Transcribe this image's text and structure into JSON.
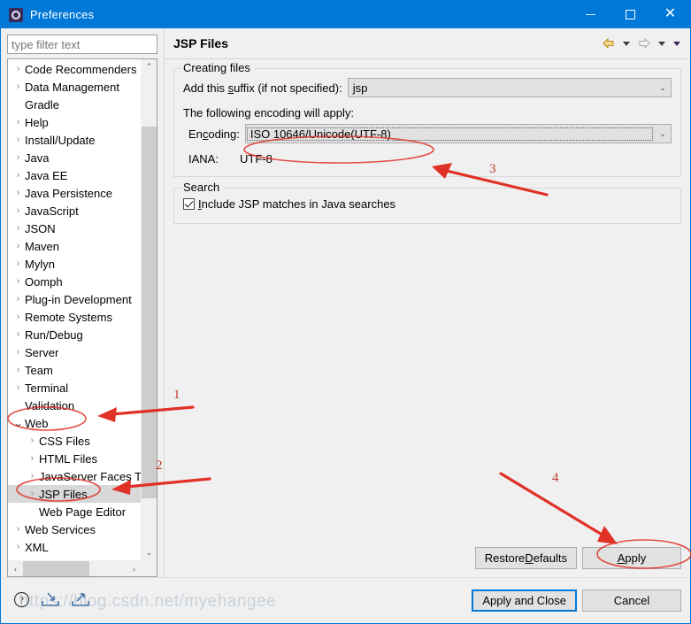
{
  "window": {
    "title": "Preferences",
    "icon": "gear-icon",
    "accent_color": "#0078d7",
    "controls": {
      "minimize": "—",
      "maximize": "□",
      "close": "✕"
    }
  },
  "sidebar": {
    "filter": {
      "placeholder": "type filter text",
      "value": ""
    },
    "tree": [
      {
        "label": "Code Recommenders",
        "expandable": true,
        "expanded": false,
        "indent": 0,
        "selected": false
      },
      {
        "label": "Data Management",
        "expandable": true,
        "expanded": false,
        "indent": 0,
        "selected": false
      },
      {
        "label": "Gradle",
        "expandable": false,
        "expanded": false,
        "indent": 0,
        "selected": false
      },
      {
        "label": "Help",
        "expandable": true,
        "expanded": false,
        "indent": 0,
        "selected": false
      },
      {
        "label": "Install/Update",
        "expandable": true,
        "expanded": false,
        "indent": 0,
        "selected": false
      },
      {
        "label": "Java",
        "expandable": true,
        "expanded": false,
        "indent": 0,
        "selected": false
      },
      {
        "label": "Java EE",
        "expandable": true,
        "expanded": false,
        "indent": 0,
        "selected": false
      },
      {
        "label": "Java Persistence",
        "expandable": true,
        "expanded": false,
        "indent": 0,
        "selected": false
      },
      {
        "label": "JavaScript",
        "expandable": true,
        "expanded": false,
        "indent": 0,
        "selected": false
      },
      {
        "label": "JSON",
        "expandable": true,
        "expanded": false,
        "indent": 0,
        "selected": false
      },
      {
        "label": "Maven",
        "expandable": true,
        "expanded": false,
        "indent": 0,
        "selected": false
      },
      {
        "label": "Mylyn",
        "expandable": true,
        "expanded": false,
        "indent": 0,
        "selected": false
      },
      {
        "label": "Oomph",
        "expandable": true,
        "expanded": false,
        "indent": 0,
        "selected": false
      },
      {
        "label": "Plug-in Development",
        "expandable": true,
        "expanded": false,
        "indent": 0,
        "selected": false
      },
      {
        "label": "Remote Systems",
        "expandable": true,
        "expanded": false,
        "indent": 0,
        "selected": false
      },
      {
        "label": "Run/Debug",
        "expandable": true,
        "expanded": false,
        "indent": 0,
        "selected": false
      },
      {
        "label": "Server",
        "expandable": true,
        "expanded": false,
        "indent": 0,
        "selected": false
      },
      {
        "label": "Team",
        "expandable": true,
        "expanded": false,
        "indent": 0,
        "selected": false
      },
      {
        "label": "Terminal",
        "expandable": true,
        "expanded": false,
        "indent": 0,
        "selected": false
      },
      {
        "label": "Validation",
        "expandable": false,
        "expanded": false,
        "indent": 0,
        "selected": false
      },
      {
        "label": "Web",
        "expandable": true,
        "expanded": true,
        "indent": 0,
        "selected": false
      },
      {
        "label": "CSS Files",
        "expandable": true,
        "expanded": false,
        "indent": 1,
        "selected": false
      },
      {
        "label": "HTML Files",
        "expandable": true,
        "expanded": false,
        "indent": 1,
        "selected": false
      },
      {
        "label": "JavaServer Faces To",
        "expandable": true,
        "expanded": false,
        "indent": 1,
        "selected": false
      },
      {
        "label": "JSP Files",
        "expandable": true,
        "expanded": false,
        "indent": 1,
        "selected": true
      },
      {
        "label": "Web Page Editor",
        "expandable": false,
        "expanded": false,
        "indent": 1,
        "selected": false
      },
      {
        "label": "Web Services",
        "expandable": true,
        "expanded": false,
        "indent": 0,
        "selected": false
      },
      {
        "label": "XML",
        "expandable": true,
        "expanded": false,
        "indent": 0,
        "selected": false
      }
    ],
    "scroll": {
      "up_arrow": "⌃",
      "down_arrow": "⌄",
      "left_arrow": "‹",
      "right_arrow": "›"
    }
  },
  "page": {
    "title": "JSP Files",
    "nav": {
      "back": "back-arrow-icon",
      "back_menu": "chevron-down-icon",
      "forward": "forward-arrow-icon",
      "forward_menu": "chevron-down-icon",
      "view_menu": "chevron-down-icon"
    },
    "creating_files": {
      "legend": "Creating files",
      "suffix_label_pre": "Add this ",
      "suffix_label_key": "s",
      "suffix_label_post": "uffix (if not specified):",
      "suffix_value": "jsp",
      "encoding_note": "The following encoding will apply:",
      "encoding_label_pre": "En",
      "encoding_label_key": "c",
      "encoding_label_post": "oding:",
      "encoding_value": "ISO 10646/Unicode(UTF-8)",
      "iana_label": "IANA:",
      "iana_value": "UTF-8",
      "dropdown_arrow": "⌄"
    },
    "search": {
      "legend": "Search",
      "checkbox_label_key": "I",
      "checkbox_label_rest": "nclude JSP matches in Java searches",
      "checked": true
    },
    "buttons": {
      "restore_defaults_pre": "Restore ",
      "restore_defaults_key": "D",
      "restore_defaults_post": "efaults",
      "apply_pre": "",
      "apply_key": "A",
      "apply_post": "pply"
    }
  },
  "footer": {
    "icons": [
      {
        "name": "help-icon",
        "glyph": "?"
      },
      {
        "name": "import-icon",
        "glyph": "import"
      },
      {
        "name": "export-icon",
        "glyph": "export"
      }
    ],
    "apply_and_close": "Apply and Close",
    "cancel": "Cancel"
  },
  "annotations": {
    "color": "#e03127",
    "markers": [
      {
        "number": "1",
        "target": "sidebar-item-web"
      },
      {
        "number": "2",
        "target": "sidebar-item-jsp-files"
      },
      {
        "number": "3",
        "target": "encoding-combo"
      },
      {
        "number": "4",
        "target": "apply-button"
      }
    ]
  },
  "watermark": {
    "text": "https://blog.csdn.net/myehangee"
  }
}
